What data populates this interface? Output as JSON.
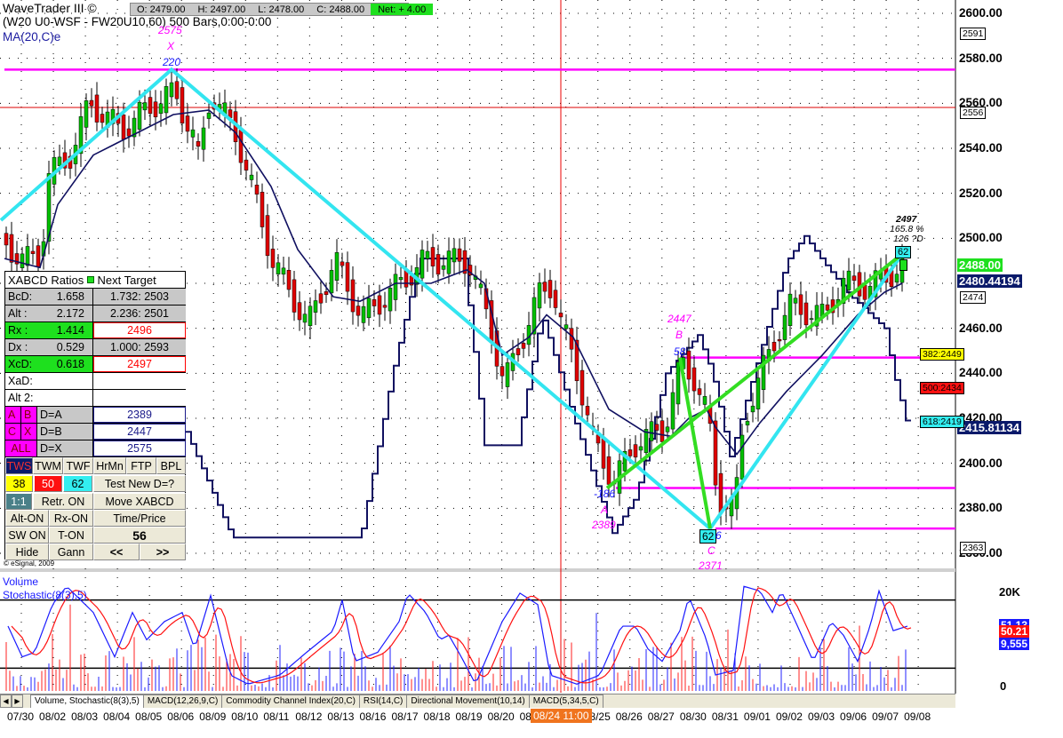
{
  "header": {
    "app_title": "WaveTrader III ©",
    "symbol_line": "(W20 U0-WSF - FW20U10,60) 500 Bars,0:00-0:00",
    "ma_label": "MA(20,C)e",
    "open": "O: 2479.00",
    "high": "H: 2497.00",
    "low": "L: 2478.00",
    "close": "C: 2488.00",
    "net": "Net: + 4.00"
  },
  "price_axis": {
    "ticks": [
      "2600.00",
      "2580.00",
      "2560.00",
      "2540.00",
      "2520.00",
      "2500.00",
      "2480.00",
      "2460.00",
      "2440.00",
      "2420.00",
      "2400.00",
      "2380.00",
      "2360.00"
    ],
    "last_price": "2488.00",
    "ma_value": "2480.44194",
    "cycle_value": "2415.81134"
  },
  "level_boxes": {
    "b2591": "2591",
    "b2556": "2556",
    "b2474": "2474",
    "b2363": "2363",
    "fib382": "382:2449",
    "fib500": "500:2434",
    "fib618": "618:2419"
  },
  "pattern_labels": {
    "x_price": "2575",
    "x_name": "X",
    "x_bars": "220",
    "a_price": "2389",
    "a_name": "A",
    "a_bars": "-186",
    "b_price": "2447",
    "b_name": "B",
    "b_bars": "58",
    "c_price": "2371",
    "c_name": "C",
    "c_box": "62",
    "c_bars": "6",
    "d_price": "2497",
    "d_pct": "165.8 %",
    "d_info": "126 ?D",
    "d_box": "62"
  },
  "xabcd_panel": {
    "title": "XABCD Ratios",
    "next_target": "Next Target",
    "rows": [
      {
        "label": "BcD:",
        "ratio": "1.658",
        "target": "1.732: 2503"
      },
      {
        "label": "Alt  :",
        "ratio": "2.172",
        "target": "2.236: 2501"
      },
      {
        "label": "Rx   :",
        "ratio": "1.414",
        "target": "2496"
      },
      {
        "label": "Dx   :",
        "ratio": "0.529",
        "target": "1.000: 2593"
      },
      {
        "label": "XcD:",
        "ratio": "0.618",
        "target": "2497"
      },
      {
        "label": "XaD:",
        "ratio": "",
        "target": ""
      },
      {
        "label": "Alt 2:",
        "ratio": "",
        "target": ""
      }
    ],
    "point_rows": [
      {
        "k1": "A",
        "k2": "B",
        "eq": "D=A",
        "val": "2389"
      },
      {
        "k1": "C",
        "k2": "X",
        "eq": "D=B",
        "val": "2447"
      },
      {
        "k1": "ALL",
        "k2": "",
        "eq": "D=X",
        "val": "2575"
      }
    ],
    "buttons": {
      "tws": "TWS",
      "twm": "TWM",
      "twf": "TWF",
      "hrmn": "HrMn",
      "ftp": "FTP",
      "bpl": "BPL",
      "r38": "38",
      "r50": "50",
      "r62": "62",
      "test": "Test New D=?",
      "one": "1:1",
      "retr": "Retr. ON",
      "move": "Move XABCD",
      "alt": "Alt-ON",
      "rx": "Rx-ON",
      "timeprice": "Time/Price",
      "sw": "SW ON",
      "ton": "T-ON",
      "count": "56",
      "hide": "Hide",
      "gann": "Gann",
      "prev": "<<",
      "next": ">>"
    },
    "copyright": "© eSignal, 2009"
  },
  "lower_panel": {
    "title1": "Volume",
    "title2": "Stochastic(8(3),5)",
    "vol_max": "20K",
    "vol_zero": "0",
    "stoch_k": "51.13",
    "stoch_d": "50.21",
    "volume": "9,555"
  },
  "tabs": [
    "Volume, Stochastic(8(3),5)",
    "MACD(12,26,9,C)",
    "Commodity Channel Index(20,C)",
    "RSI(14,C)",
    "Directional Movement(10,14)",
    "MACD(5,34,5,C)"
  ],
  "dates": [
    "07/30",
    "08/02",
    "08/03",
    "08/04",
    "08/05",
    "08/06",
    "08/09",
    "08/10",
    "08/11",
    "08/12",
    "08/13",
    "08/16",
    "08/17",
    "08/18",
    "08/19",
    "08/20",
    "08/23",
    "08/24",
    "08/25",
    "08/26",
    "08/27",
    "08/30",
    "08/31",
    "09/01",
    "09/02",
    "09/03",
    "09/06",
    "09/07",
    "09/08"
  ],
  "cursor_date": "08/24 11:00",
  "colors": {
    "up": "#00c000",
    "down": "#e00000",
    "ma": "#101060",
    "pattern_xc": "#33e5f0",
    "pattern_abd": "#33dd22",
    "level": "#ff00ff"
  },
  "chart_data": {
    "type": "candlestick",
    "bars": 500,
    "ylim": [
      2360,
      2600
    ],
    "price_path": [
      [
        0,
        2497
      ],
      [
        10,
        2490
      ],
      [
        20,
        2492
      ],
      [
        23,
        2528
      ],
      [
        35,
        2535
      ],
      [
        47,
        2560
      ],
      [
        65,
        2548
      ],
      [
        80,
        2558
      ],
      [
        95,
        2565
      ],
      [
        105,
        2545
      ],
      [
        108,
        2535
      ],
      [
        115,
        2565
      ],
      [
        130,
        2545
      ],
      [
        150,
        2490
      ],
      [
        160,
        2475
      ],
      [
        170,
        2462
      ],
      [
        185,
        2490
      ],
      [
        200,
        2465
      ],
      [
        215,
        2475
      ],
      [
        235,
        2490
      ],
      [
        260,
        2490
      ],
      [
        272,
        2462
      ],
      [
        280,
        2435
      ],
      [
        290,
        2455
      ],
      [
        300,
        2475
      ],
      [
        307,
        2480
      ],
      [
        312,
        2462
      ],
      [
        320,
        2445
      ],
      [
        330,
        2410
      ],
      [
        342,
        2392
      ],
      [
        355,
        2410
      ],
      [
        370,
        2415
      ],
      [
        380,
        2445
      ],
      [
        387,
        2438
      ],
      [
        395,
        2420
      ],
      [
        400,
        2385
      ],
      [
        410,
        2380
      ],
      [
        415,
        2420
      ],
      [
        430,
        2450
      ],
      [
        440,
        2470
      ],
      [
        460,
        2465
      ],
      [
        470,
        2480
      ],
      [
        485,
        2478
      ],
      [
        495,
        2483
      ],
      [
        505,
        2488
      ]
    ],
    "ma20": [
      [
        0,
        2491
      ],
      [
        20,
        2487
      ],
      [
        30,
        2515
      ],
      [
        50,
        2537
      ],
      [
        65,
        2543
      ],
      [
        95,
        2555
      ],
      [
        115,
        2557
      ],
      [
        130,
        2547
      ],
      [
        150,
        2523
      ],
      [
        165,
        2495
      ],
      [
        185,
        2474
      ],
      [
        200,
        2472
      ],
      [
        220,
        2480
      ],
      [
        240,
        2480
      ],
      [
        260,
        2486
      ],
      [
        270,
        2480
      ],
      [
        280,
        2448
      ],
      [
        295,
        2456
      ],
      [
        305,
        2466
      ],
      [
        320,
        2456
      ],
      [
        340,
        2424
      ],
      [
        360,
        2414
      ],
      [
        375,
        2412
      ],
      [
        385,
        2420
      ],
      [
        395,
        2424
      ],
      [
        400,
        2416
      ],
      [
        412,
        2404
      ],
      [
        425,
        2418
      ],
      [
        440,
        2432
      ],
      [
        460,
        2448
      ],
      [
        480,
        2466
      ],
      [
        495,
        2476
      ],
      [
        505,
        2480
      ]
    ],
    "cycle": [
      [
        102,
        2414
      ],
      [
        128,
        2367
      ],
      [
        200,
        2367
      ],
      [
        218,
        2440
      ],
      [
        233,
        2491
      ],
      [
        258,
        2491
      ],
      [
        270,
        2408
      ],
      [
        288,
        2408
      ],
      [
        302,
        2466
      ],
      [
        320,
        2420
      ],
      [
        342,
        2369
      ],
      [
        355,
        2385
      ],
      [
        372,
        2440
      ],
      [
        390,
        2457
      ],
      [
        398,
        2440
      ],
      [
        408,
        2403
      ],
      [
        425,
        2450
      ],
      [
        440,
        2490
      ],
      [
        450,
        2501
      ],
      [
        460,
        2490
      ],
      [
        475,
        2475
      ],
      [
        495,
        2460
      ],
      [
        500,
        2440
      ],
      [
        508,
        2416
      ]
    ],
    "levels": [
      {
        "price": 2575,
        "from": 0
      },
      {
        "price": 2447,
        "from": 380
      },
      {
        "price": 2389,
        "from": 344
      },
      {
        "price": 2371,
        "from": 400
      }
    ],
    "pattern": {
      "start": [
        -2,
        2508
      ],
      "X": [
        94,
        2575
      ],
      "A": [
        339,
        2389
      ],
      "B": [
        380,
        2447
      ],
      "C": [
        397,
        2371
      ],
      "D": [
        505,
        2493
      ]
    },
    "cursor_bar": 313,
    "stochastic": [
      [
        2,
        57
      ],
      [
        10,
        30
      ],
      [
        17,
        34
      ],
      [
        27,
        76
      ],
      [
        35,
        92
      ],
      [
        50,
        69
      ],
      [
        62,
        30
      ],
      [
        72,
        69
      ],
      [
        80,
        45
      ],
      [
        90,
        61
      ],
      [
        100,
        69
      ],
      [
        107,
        37
      ],
      [
        116,
        84
      ],
      [
        127,
        14
      ],
      [
        137,
        6
      ],
      [
        155,
        14
      ],
      [
        170,
        34
      ],
      [
        185,
        53
      ],
      [
        190,
        80
      ],
      [
        197,
        26
      ],
      [
        210,
        34
      ],
      [
        222,
        61
      ],
      [
        227,
        86
      ],
      [
        237,
        69
      ],
      [
        245,
        45
      ],
      [
        250,
        49
      ],
      [
        257,
        30
      ],
      [
        265,
        6
      ],
      [
        280,
        61
      ],
      [
        290,
        86
      ],
      [
        300,
        76
      ],
      [
        307,
        14
      ],
      [
        322,
        6
      ],
      [
        335,
        14
      ],
      [
        347,
        57
      ],
      [
        355,
        57
      ],
      [
        362,
        37
      ],
      [
        370,
        26
      ],
      [
        380,
        53
      ],
      [
        385,
        83
      ],
      [
        395,
        45
      ],
      [
        400,
        14
      ],
      [
        410,
        18
      ],
      [
        416,
        92
      ],
      [
        425,
        88
      ],
      [
        432,
        69
      ],
      [
        437,
        88
      ],
      [
        445,
        61
      ],
      [
        455,
        26
      ],
      [
        465,
        61
      ],
      [
        472,
        49
      ],
      [
        480,
        26
      ],
      [
        487,
        57
      ],
      [
        492,
        88
      ],
      [
        500,
        53
      ],
      [
        508,
        57
      ]
    ]
  }
}
